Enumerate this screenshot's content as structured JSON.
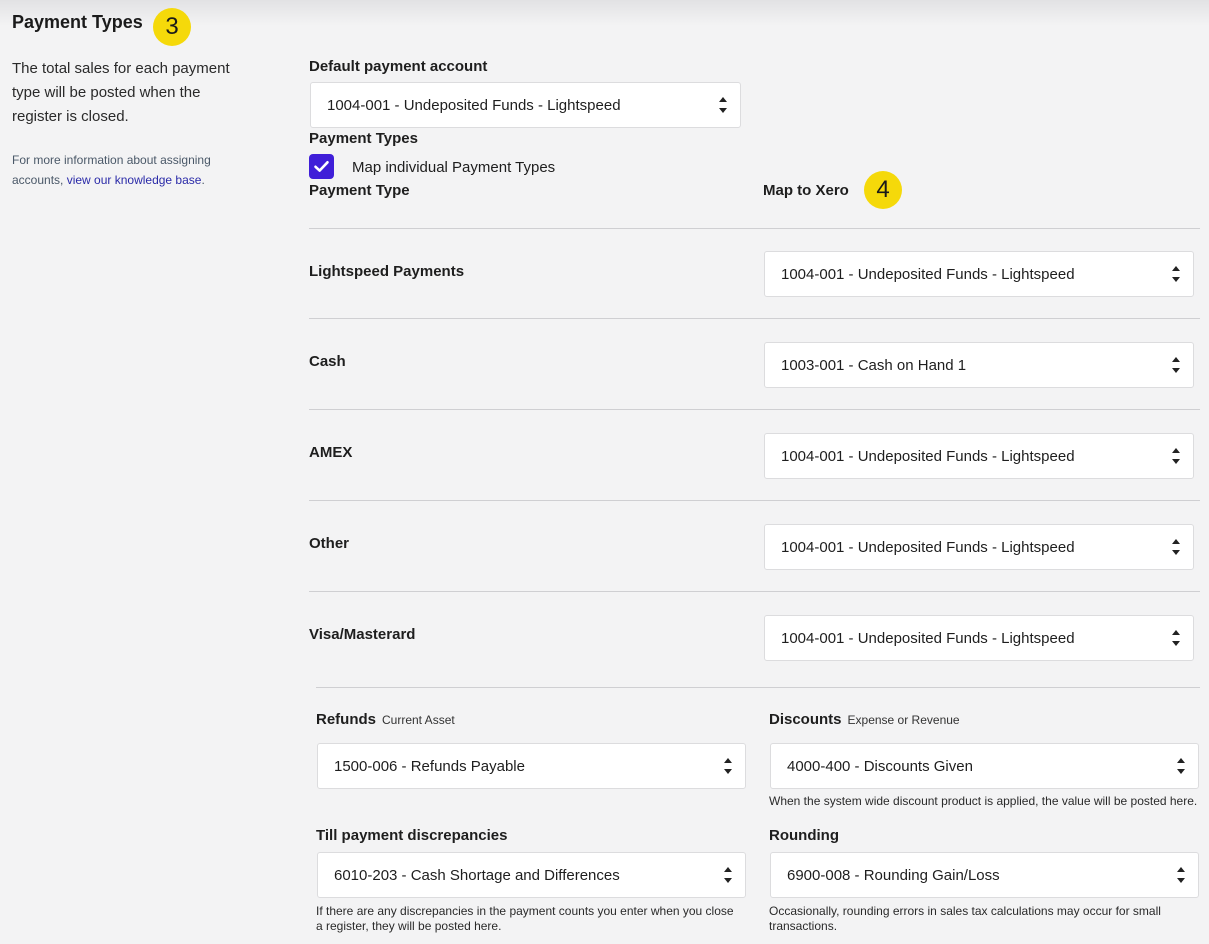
{
  "section": {
    "title": "Payment Types",
    "step_badge": "3",
    "description": "The total sales for each payment type will be posted when the register is closed.",
    "info_prefix": "For more information about assigning accounts, ",
    "info_link": "view our knowledge base",
    "info_suffix": "."
  },
  "default_account": {
    "label": "Default payment account",
    "value": "1004-001 - Undeposited Funds - Lightspeed"
  },
  "payment_types": {
    "label": "Payment Types",
    "map_checkbox_label": "Map individual Payment Types",
    "map_checked": true,
    "col_type": "Payment Type",
    "col_map": "Map to Xero",
    "map_badge": "4",
    "rows": [
      {
        "name": "Lightspeed Payments",
        "account": "1004-001 - Undeposited Funds - Lightspeed"
      },
      {
        "name": "Cash",
        "account": "1003-001 - Cash on Hand 1"
      },
      {
        "name": "AMEX",
        "account": "1004-001 - Undeposited Funds - Lightspeed"
      },
      {
        "name": "Other",
        "account": "1004-001 - Undeposited Funds - Lightspeed"
      },
      {
        "name": "Visa/Masterard",
        "account": "1004-001 - Undeposited Funds - Lightspeed"
      }
    ]
  },
  "refunds": {
    "label": "Refunds",
    "sub": "Current Asset",
    "value": "1500-006 - Refunds Payable"
  },
  "discounts": {
    "label": "Discounts",
    "sub": "Expense or Revenue",
    "value": "4000-400 - Discounts Given",
    "help": "When the system wide discount product is applied, the value will be posted here."
  },
  "till": {
    "label": "Till payment discrepancies",
    "value": "6010-203 - Cash Shortage and Differences",
    "help": "If there are any discrepancies in the payment counts you enter when you close a register, they will be posted here."
  },
  "rounding": {
    "label": "Rounding",
    "value": "6900-008 - Rounding Gain/Loss",
    "help": "Occasionally, rounding errors in sales tax calculations may occur for small transactions."
  },
  "colors": {
    "badge": "#f5d90a",
    "checkbox": "#3f1ed8",
    "link": "#2a2aa8"
  }
}
